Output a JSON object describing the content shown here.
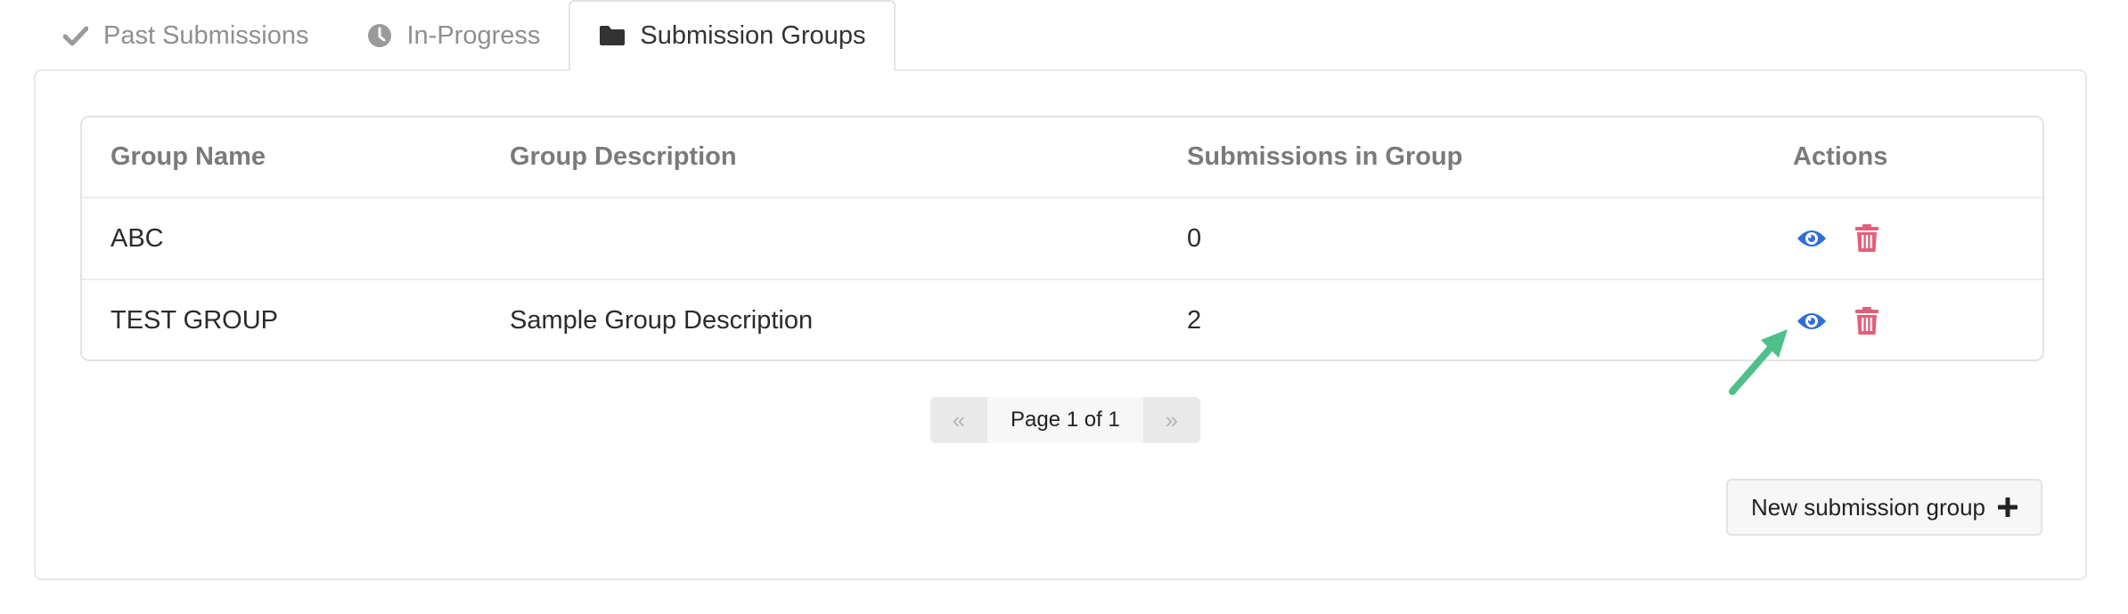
{
  "tabs": [
    {
      "label": "Past Submissions",
      "icon": "check-icon",
      "active": false
    },
    {
      "label": "In-Progress",
      "icon": "clock-icon",
      "active": false
    },
    {
      "label": "Submission Groups",
      "icon": "folder-icon",
      "active": true
    }
  ],
  "table": {
    "columns": [
      "Group Name",
      "Group Description",
      "Submissions in Group",
      "Actions"
    ],
    "rows": [
      {
        "name": "ABC",
        "description": "",
        "count": "0"
      },
      {
        "name": "TEST GROUP",
        "description": "Sample Group Description",
        "count": "2"
      }
    ]
  },
  "pagination": {
    "prev": "«",
    "label": "Page 1 of 1",
    "next": "»"
  },
  "new_group_button": {
    "label": "New submission group",
    "icon": "plus-icon"
  },
  "colors": {
    "view_icon": "#2f6fd6",
    "delete_icon": "#e0607a",
    "annotation_arrow": "#4ec08a",
    "muted_tab": "#8f8f8f"
  }
}
